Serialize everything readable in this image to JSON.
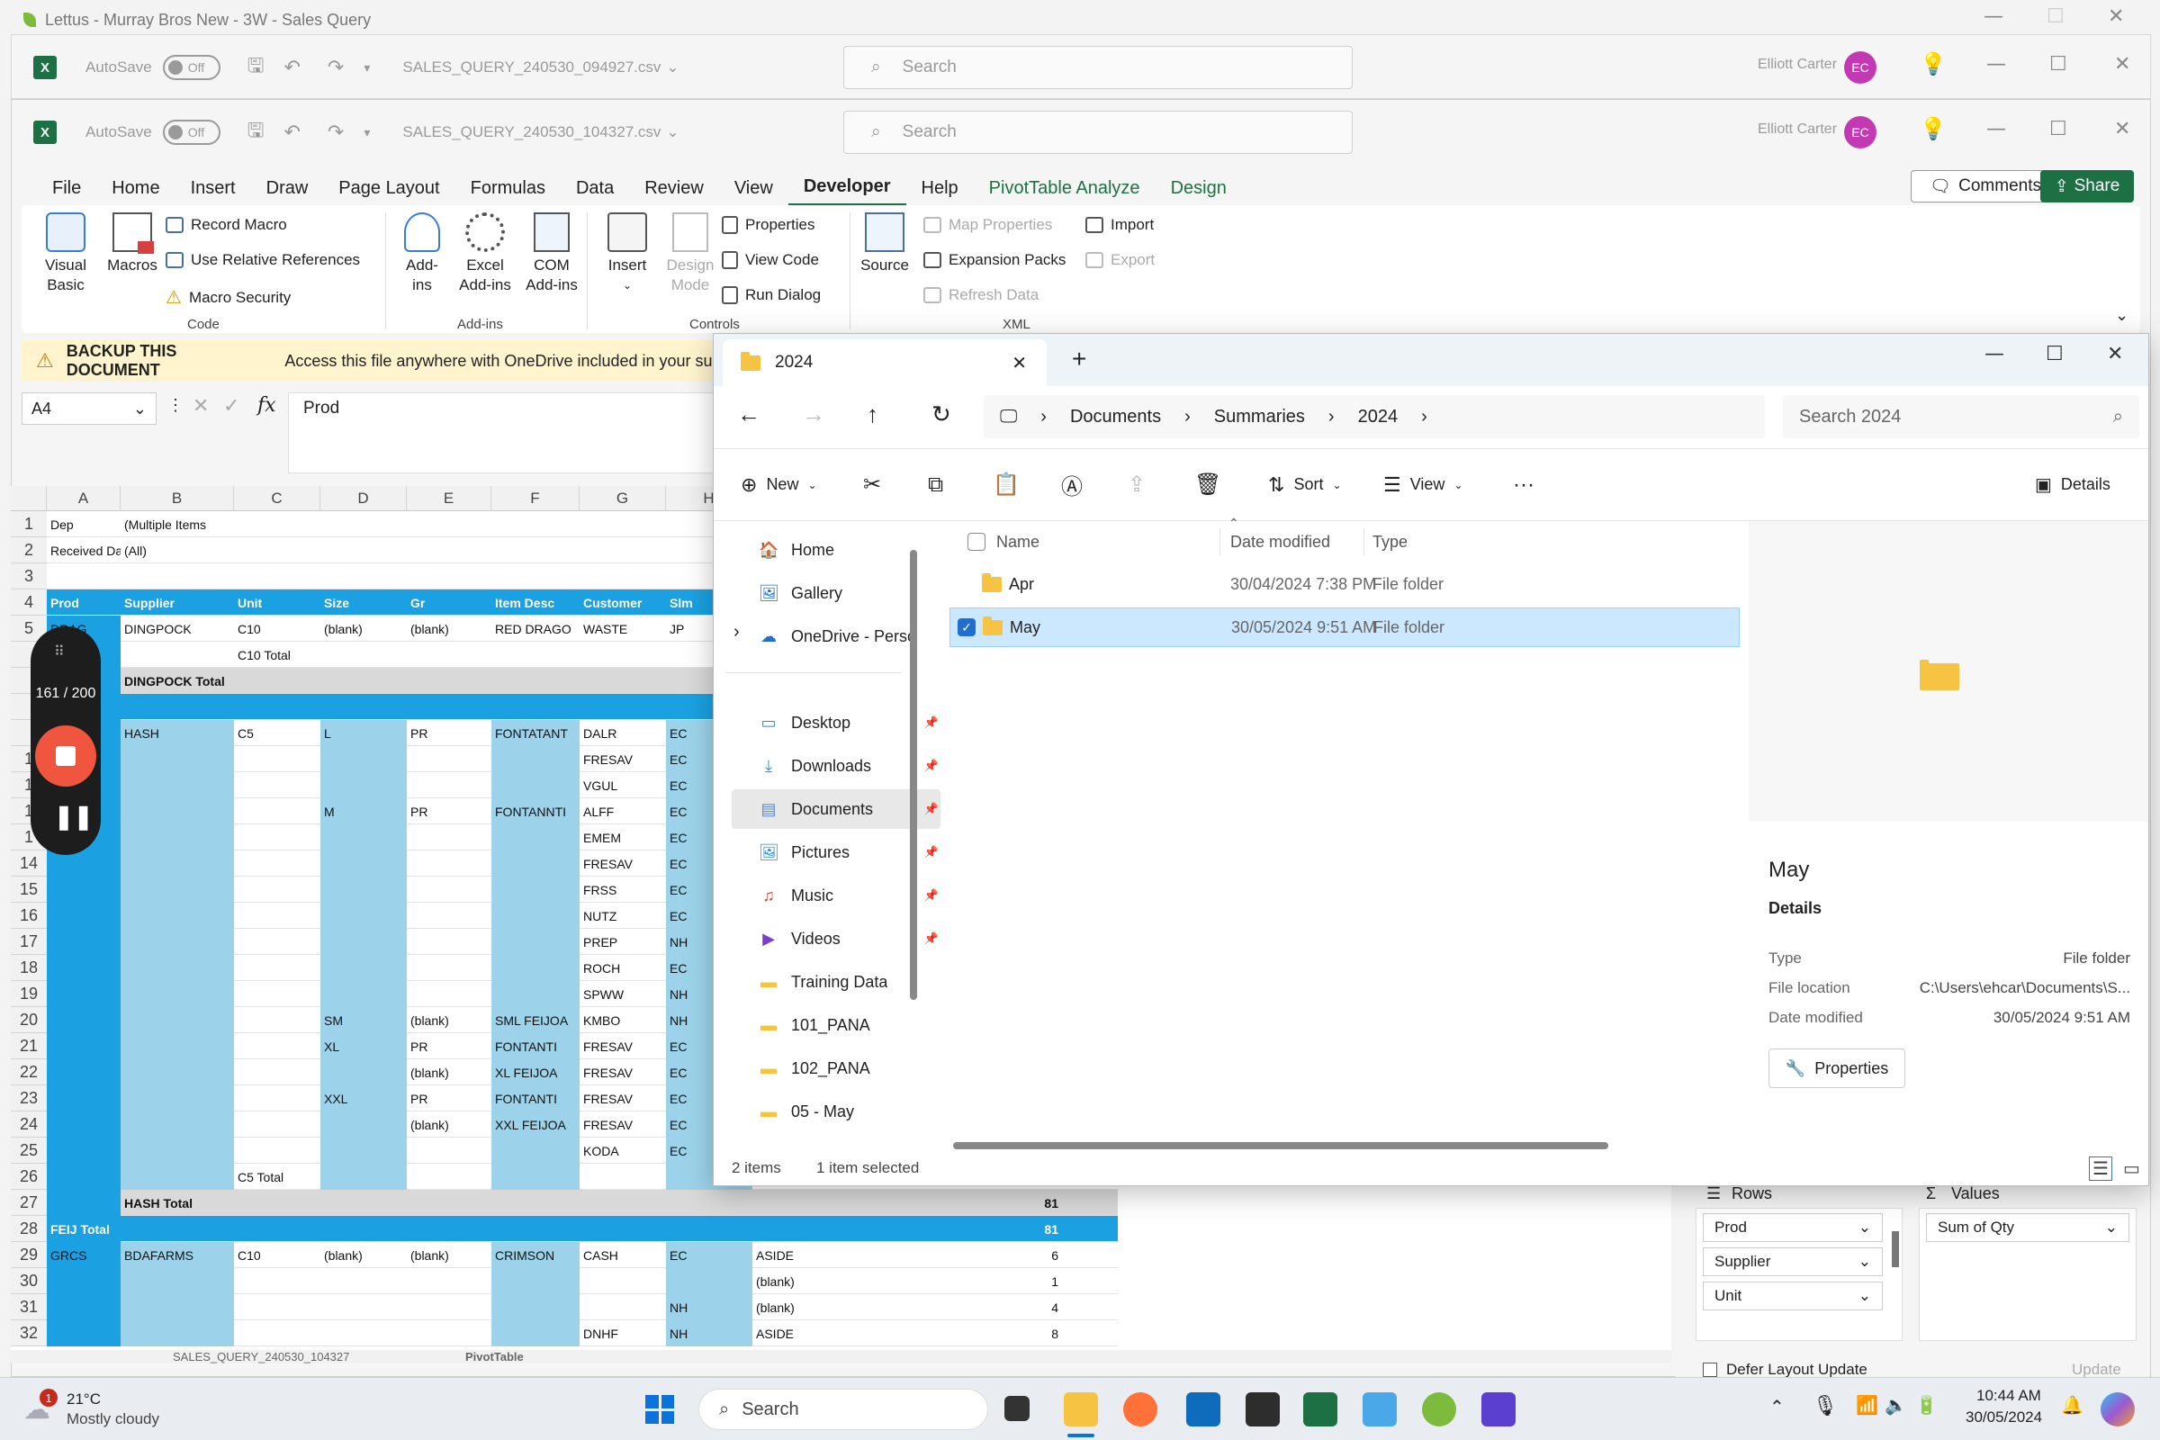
{
  "outer": {
    "title": "Lettus - Murray Bros New - 3W - Sales Query"
  },
  "excel_back": {
    "autosave": "AutoSave",
    "toggle": "Off",
    "filename": "SALES_QUERY_240530_094927.csv",
    "search": "Search",
    "user": "Elliott Carter",
    "initials": "EC"
  },
  "excel_front": {
    "autosave": "AutoSave",
    "toggle": "Off",
    "filename": "SALES_QUERY_240530_104327.csv",
    "search": "Search",
    "user": "Elliott Carter",
    "initials": "EC"
  },
  "menu": {
    "items": [
      "File",
      "Home",
      "Insert",
      "Draw",
      "Page Layout",
      "Formulas",
      "Data",
      "Review",
      "View",
      "Developer",
      "Help",
      "PivotTable Analyze",
      "Design"
    ],
    "active": "Developer",
    "comments": "Comments",
    "share": "Share"
  },
  "ribbon": {
    "code": {
      "visual_basic": "Visual\nBasic",
      "macros": "Macros",
      "record_macro": "Record Macro",
      "relative_refs": "Use Relative References",
      "macro_security": "Macro Security",
      "group": "Code"
    },
    "addins": {
      "addins": "Add-\nins",
      "excel_addins": "Excel\nAdd-ins",
      "com_addins": "COM\nAdd-ins",
      "group": "Add-ins"
    },
    "controls": {
      "insert": "Insert",
      "design_mode": "Design\nMode",
      "properties": "Properties",
      "view_code": "View Code",
      "run_dialog": "Run Dialog",
      "group": "Controls"
    },
    "xml": {
      "source": "Source",
      "map_properties": "Map Properties",
      "expansion_packs": "Expansion Packs",
      "refresh_data": "Refresh Data",
      "import": "Import",
      "export": "Export",
      "group": "XML"
    }
  },
  "warning": {
    "title": "BACKUP THIS DOCUMENT",
    "text": "Access this file anywhere with OneDrive included in your subs"
  },
  "formula": {
    "namebox": "A4",
    "fx_label": "fx",
    "value": "Prod"
  },
  "sheet": {
    "columns": [
      "A",
      "B",
      "C",
      "D",
      "E",
      "F",
      "G",
      "H"
    ],
    "rows": [
      {
        "n": "1",
        "cells": {
          "A": "Dep",
          "B": "(Multiple Items"
        }
      },
      {
        "n": "2",
        "cells": {
          "A": "Received Da",
          "B": "(All)"
        }
      },
      {
        "n": "3",
        "cells": {}
      },
      {
        "n": "4",
        "cells": {
          "A": "Prod",
          "B": "Supplier",
          "C": "Unit",
          "D": "Size",
          "E": "Gr",
          "F": "Item Desc",
          "G": "Customer",
          "H": "Slm"
        }
      },
      {
        "n": "5",
        "cells": {
          "A": "DRAG",
          "B": "DINGPOCK",
          "C": "C10",
          "D": "(blank)",
          "E": "(blank)",
          "F": "RED DRAGO",
          "G": "WASTE",
          "H": "JP"
        }
      },
      {
        "n": "",
        "cells": {
          "C": "C10 Total"
        }
      },
      {
        "n": "",
        "cells": {
          "B": "DINGPOCK Total"
        }
      },
      {
        "n": "",
        "cells": {
          "A": "tal"
        }
      },
      {
        "n": "",
        "cells": {
          "B": "HASH",
          "C": "C5",
          "D": "L",
          "E": "PR",
          "F": "FONTATANT",
          "G": "DALR",
          "H": "EC"
        }
      },
      {
        "n": "1",
        "cells": {
          "G": "FRESAV",
          "H": "EC"
        }
      },
      {
        "n": "1",
        "cells": {
          "G": "VGUL",
          "H": "EC"
        }
      },
      {
        "n": "1",
        "cells": {
          "D": "M",
          "E": "PR",
          "F": "FONTANNTI",
          "G": "ALFF",
          "H": "EC"
        }
      },
      {
        "n": "1",
        "cells": {
          "G": "EMEM",
          "H": "EC"
        }
      },
      {
        "n": "14",
        "cells": {
          "G": "FRESAV",
          "H": "EC"
        }
      },
      {
        "n": "15",
        "cells": {
          "G": "FRSS",
          "H": "EC"
        }
      },
      {
        "n": "16",
        "cells": {
          "G": "NUTZ",
          "H": "EC"
        }
      },
      {
        "n": "17",
        "cells": {
          "G": "PREP",
          "H": "NH"
        }
      },
      {
        "n": "18",
        "cells": {
          "G": "ROCH",
          "H": "EC"
        }
      },
      {
        "n": "19",
        "cells": {
          "G": "SPWW",
          "H": "NH"
        }
      },
      {
        "n": "20",
        "cells": {
          "D": "SM",
          "E": "(blank)",
          "F": "SML FEIJOA",
          "G": "KMBO",
          "H": "NH"
        }
      },
      {
        "n": "21",
        "cells": {
          "D": "XL",
          "E": "PR",
          "F": "FONTANTI",
          "G": "FRESAV",
          "H": "EC"
        }
      },
      {
        "n": "22",
        "cells": {
          "E": "(blank)",
          "F": "XL FEIJOA",
          "G": "FRESAV",
          "H": "EC"
        }
      },
      {
        "n": "23",
        "cells": {
          "D": "XXL",
          "E": "PR",
          "F": "FONTANTI",
          "G": "FRESAV",
          "H": "EC"
        }
      },
      {
        "n": "24",
        "cells": {
          "E": "(blank)",
          "F": "XXL FEIJOA",
          "G": "FRESAV",
          "H": "EC"
        }
      },
      {
        "n": "25",
        "cells": {
          "G": "KODA",
          "H": "EC"
        }
      },
      {
        "n": "26",
        "cells": {
          "C": "C5 Total"
        }
      },
      {
        "n": "27",
        "cells": {
          "B": "HASH Total",
          "V": "81"
        }
      },
      {
        "n": "28",
        "cells": {
          "A": "FEIJ Total",
          "V": "81"
        }
      },
      {
        "n": "29",
        "cells": {
          "A": "GRCS",
          "B": "BDAFARMS",
          "C": "C10",
          "D": "(blank)",
          "E": "(blank)",
          "F": "CRIMSON",
          "G": "CASH",
          "H": "EC",
          "I": "ASIDE",
          "V": "6"
        }
      },
      {
        "n": "30",
        "cells": {
          "I": "(blank)",
          "V": "1"
        }
      },
      {
        "n": "31",
        "cells": {
          "H": "NH",
          "I": "(blank)",
          "V": "4"
        }
      },
      {
        "n": "32",
        "cells": {
          "G": "DNHF",
          "H": "NH",
          "I": "ASIDE",
          "V": "8"
        }
      }
    ],
    "sheet_tab_1": "SALES_QUERY_240530_104327",
    "sheet_tab_2": "PivotTable"
  },
  "explorer": {
    "tab_title": "2024",
    "breadcrumb": [
      "Documents",
      "Summaries",
      "2024"
    ],
    "search_placeholder": "Search 2024",
    "commands": {
      "new": "New",
      "sort": "Sort",
      "view": "View",
      "details": "Details"
    },
    "sidebar": [
      "Home",
      "Gallery",
      "OneDrive - Perso",
      "Desktop",
      "Downloads",
      "Documents",
      "Pictures",
      "Music",
      "Videos",
      "Training Data",
      "101_PANA",
      "102_PANA",
      "05 - May"
    ],
    "columns": {
      "name": "Name",
      "date": "Date modified",
      "type": "Type"
    },
    "files": [
      {
        "name": "Apr",
        "date": "30/04/2024 7:38 PM",
        "type": "File folder",
        "selected": false
      },
      {
        "name": "May",
        "date": "30/05/2024 9:51 AM",
        "type": "File folder",
        "selected": true
      }
    ],
    "details_pane": {
      "name": "May",
      "heading": "Details",
      "rows": [
        {
          "label": "Type",
          "value": "File folder"
        },
        {
          "label": "File location",
          "value": "C:\\Users\\ehcar\\Documents\\S..."
        },
        {
          "label": "Date modified",
          "value": "30/05/2024 9:51 AM"
        }
      ],
      "properties_btn": "Properties"
    },
    "status": {
      "items": "2 items",
      "selected": "1 item selected"
    }
  },
  "pivot_pane": {
    "rows_label": "Rows",
    "values_label": "Values",
    "rows": [
      "Prod",
      "Supplier",
      "Unit"
    ],
    "values": [
      "Sum of Qty"
    ],
    "defer": "Defer Layout Update",
    "update": "Update"
  },
  "recorder": {
    "counter": "161 / 200"
  },
  "taskbar": {
    "weather_temp": "21°C",
    "weather_text": "Mostly cloudy",
    "weather_badge": "1",
    "search": "Search",
    "time": "10:44 AM",
    "date": "30/05/2024"
  },
  "colors": {
    "accent_green": "#1d7044",
    "pivot_blue": "#9dd3ea",
    "pivot_dark": "#1ba1e2",
    "selection": "#cce8ff"
  }
}
